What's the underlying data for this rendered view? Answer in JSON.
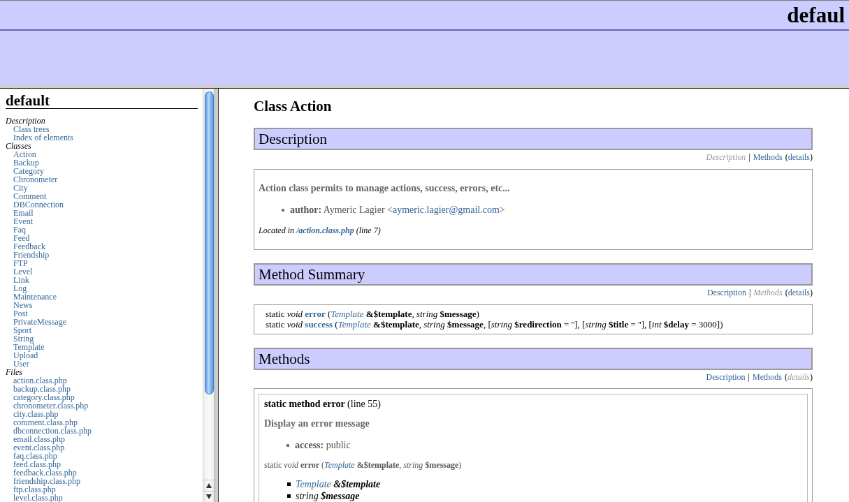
{
  "banner": {
    "title": "defaul"
  },
  "sidebar": {
    "title": "default",
    "sections": [
      {
        "label": "Description",
        "items": [
          "Class trees",
          "Index of elements"
        ]
      },
      {
        "label": "Classes",
        "items": [
          "Action",
          "Backup",
          "Category",
          "Chronometer",
          "City",
          "Comment",
          "DBConnection",
          "Email",
          "Event",
          "Faq",
          "Feed",
          "Feedback",
          "Friendship",
          "FTP",
          "Level",
          "Link",
          "Log",
          "Maintenance",
          "News",
          "Post",
          "PrivateMessage",
          "Sport",
          "String",
          "Template",
          "Upload",
          "User"
        ]
      },
      {
        "label": "Files",
        "items": [
          "action.class.php",
          "backup.class.php",
          "category.class.php",
          "chronometer.class.php",
          "city.class.php",
          "comment.class.php",
          "dbconnection.class.php",
          "email.class.php",
          "event.class.php",
          "faq.class.php",
          "feed.class.php",
          "feedback.class.php",
          "friendship.class.php",
          "ftp.class.php",
          "level.class.php"
        ]
      }
    ]
  },
  "page": {
    "title": "Class Action",
    "sections": [
      {
        "kind": "description",
        "heading": "Description",
        "nav": {
          "links": [
            {
              "label": "Description",
              "selected": true
            },
            {
              "label": "Methods",
              "selected": false
            },
            {
              "label": "details",
              "selected": false
            }
          ],
          "separator": "|",
          "brackets": [
            "(",
            ")"
          ]
        },
        "summary": "Action class permits to manage actions, success, errors, etc...",
        "tags": [
          [
            {
              "kind": "text",
              "text": "**author:** Aymeric Lagier <"
            },
            {
              "kind": "email",
              "text": "aymeric.lagier@gmail.com"
            },
            {
              "kind": "text",
              "text": ">"
            }
          ]
        ],
        "location": [
          {
            "kind": "text",
            "text": "Located in "
          },
          {
            "kind": "file",
            "text": "/action.class.php"
          },
          {
            "kind": "text",
            "text": " (line 7)"
          }
        ]
      },
      {
        "kind": "summary",
        "heading": "Method Summary",
        "nav": {
          "links": [
            {
              "label": "Description",
              "selected": false
            },
            {
              "label": "Methods",
              "selected": true
            },
            {
              "label": "details",
              "selected": false
            }
          ],
          "separator": "|",
          "brackets": [
            "(",
            ")"
          ]
        },
        "signatures": [
          [
            {
              "kind": "text",
              "text": "static *void* "
            },
            {
              "kind": "method",
              "text": "error"
            },
            {
              "kind": "text",
              "text": " ("
            },
            {
              "kind": "class",
              "text": "Template"
            },
            {
              "kind": "text",
              "text": " **&$template**, *string* **$message**)"
            }
          ],
          [
            {
              "kind": "text",
              "text": "static *void* "
            },
            {
              "kind": "method",
              "text": "success"
            },
            {
              "kind": "text",
              "text": " ("
            },
            {
              "kind": "class",
              "text": "Template"
            },
            {
              "kind": "text",
              "text": " **&$template**, *string* **$message**, [*string* **$redirection** = ''], [*string* **$title** = ''], [*int* **$delay** = 3000])"
            }
          ]
        ]
      },
      {
        "kind": "methods",
        "heading": "Methods",
        "nav": {
          "links": [
            {
              "label": "Description",
              "selected": false
            },
            {
              "label": "Methods",
              "selected": false
            },
            {
              "label": "details",
              "selected": true
            }
          ],
          "separator": "|",
          "brackets": [
            "(",
            ")"
          ]
        },
        "methods": [
          {
            "title": "**static method error** (line 55)",
            "summary": "Display an error message",
            "tags": [
              [
                {
                  "kind": "text",
                  "text": "**access:** public"
                }
              ]
            ],
            "signature": [
              {
                "kind": "text",
                "text": "static *void* **error** ("
              },
              {
                "kind": "class",
                "text": "Template"
              },
              {
                "kind": "text",
                "text": " **&$template**, *string* **$message**)"
              }
            ],
            "params": [
              [
                {
                  "kind": "class",
                  "text": "Template"
                },
                {
                  "kind": "text",
                  "text": " **&$template**"
                }
              ],
              [
                {
                  "kind": "text",
                  "text": "string **$message**"
                }
              ]
            ]
          }
        ]
      }
    ]
  }
}
